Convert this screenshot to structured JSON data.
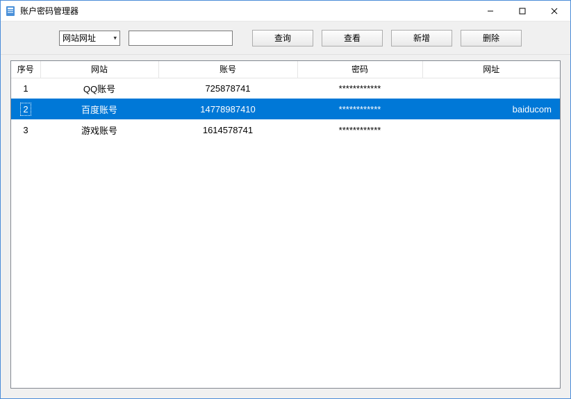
{
  "window": {
    "title": "账户密码管理器"
  },
  "toolbar": {
    "filter_type": "网站网址",
    "search_value": "",
    "buttons": {
      "query": "查询",
      "view": "查看",
      "add": "新增",
      "delete": "删除"
    }
  },
  "table": {
    "headers": {
      "index": "序号",
      "site": "网站",
      "account": "账号",
      "password": "密码",
      "url": "网址"
    },
    "rows": [
      {
        "index": "1",
        "site": "QQ账号",
        "account": "725878741",
        "password": "************",
        "url": "",
        "selected": false
      },
      {
        "index": "2",
        "site": "百度账号",
        "account": "14778987410",
        "password": "************",
        "url": "baiducom",
        "selected": true
      },
      {
        "index": "3",
        "site": "游戏账号",
        "account": "1614578741",
        "password": "************",
        "url": "",
        "selected": false
      }
    ]
  }
}
